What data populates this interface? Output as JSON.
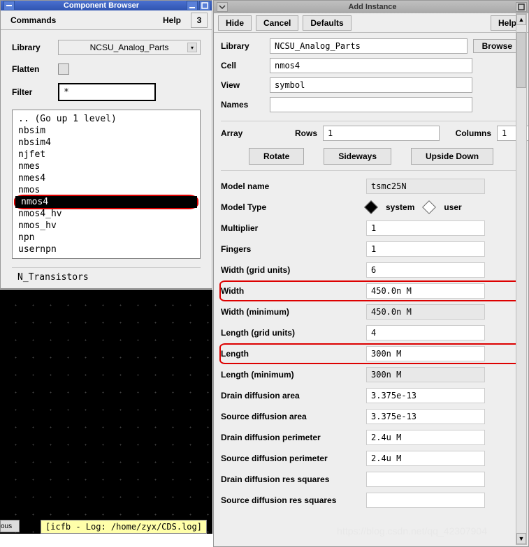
{
  "component_browser": {
    "title": "Component Browser",
    "menubar": {
      "commands": "Commands",
      "help": "Help",
      "tab": "3"
    },
    "library_label": "Library",
    "library_value": "NCSU_Analog_Parts",
    "flatten_label": "Flatten",
    "filter_label": "Filter",
    "filter_value": "*",
    "list": [
      ".. (Go up 1 level)",
      "nbsim",
      "nbsim4",
      "njfet",
      "nmes",
      "nmes4",
      "nmos",
      "nmos4",
      "nmos4_hv",
      "nmos_hv",
      "npn",
      "usernpn"
    ],
    "selected_index": 7,
    "footer": "N_Transistors"
  },
  "log_window": "[icfb - Log: /home/zyx/CDS.log]",
  "add_instance": {
    "title": "Add Instance",
    "menubar": {
      "hide": "Hide",
      "cancel": "Cancel",
      "defaults": "Defaults",
      "help": "Help"
    },
    "fields": {
      "library_label": "Library",
      "library_value": "NCSU_Analog_Parts",
      "browse": "Browse",
      "cell_label": "Cell",
      "cell_value": "nmos4",
      "view_label": "View",
      "view_value": "symbol",
      "names_label": "Names",
      "names_value": ""
    },
    "array": {
      "label": "Array",
      "rows_label": "Rows",
      "rows_value": "1",
      "cols_label": "Columns",
      "cols_value": "1"
    },
    "transform": {
      "rotate": "Rotate",
      "sideways": "Sideways",
      "upside_down": "Upside Down"
    },
    "params": [
      {
        "label": "Model name",
        "value": "tsmc25N",
        "readonly": true
      },
      {
        "label": "Model Type",
        "type": "radio",
        "options": [
          "system",
          "user"
        ],
        "selected": 0
      },
      {
        "label": "Multiplier",
        "value": "1"
      },
      {
        "label": "Fingers",
        "value": "1"
      },
      {
        "label": "Width (grid units)",
        "value": "6"
      },
      {
        "label": "Width",
        "value": "450.0n M",
        "highlight": true
      },
      {
        "label": "Width (minimum)",
        "value": "450.0n M",
        "readonly": true
      },
      {
        "label": "Length (grid units)",
        "value": "4"
      },
      {
        "label": "Length",
        "value": "300n M",
        "highlight": true
      },
      {
        "label": "Length (minimum)",
        "value": "300n M",
        "readonly": true
      },
      {
        "label": "Drain diffusion area",
        "value": "3.375e-13"
      },
      {
        "label": "Source diffusion area",
        "value": "3.375e-13"
      },
      {
        "label": "Drain diffusion perimeter",
        "value": "2.4u M"
      },
      {
        "label": "Source diffusion perimeter",
        "value": "2.4u M"
      },
      {
        "label": "Drain diffusion res squares",
        "value": ""
      },
      {
        "label": "Source diffusion res squares",
        "value": ""
      }
    ]
  },
  "watermark": "https://blog.csdn.net/qq_42307904"
}
